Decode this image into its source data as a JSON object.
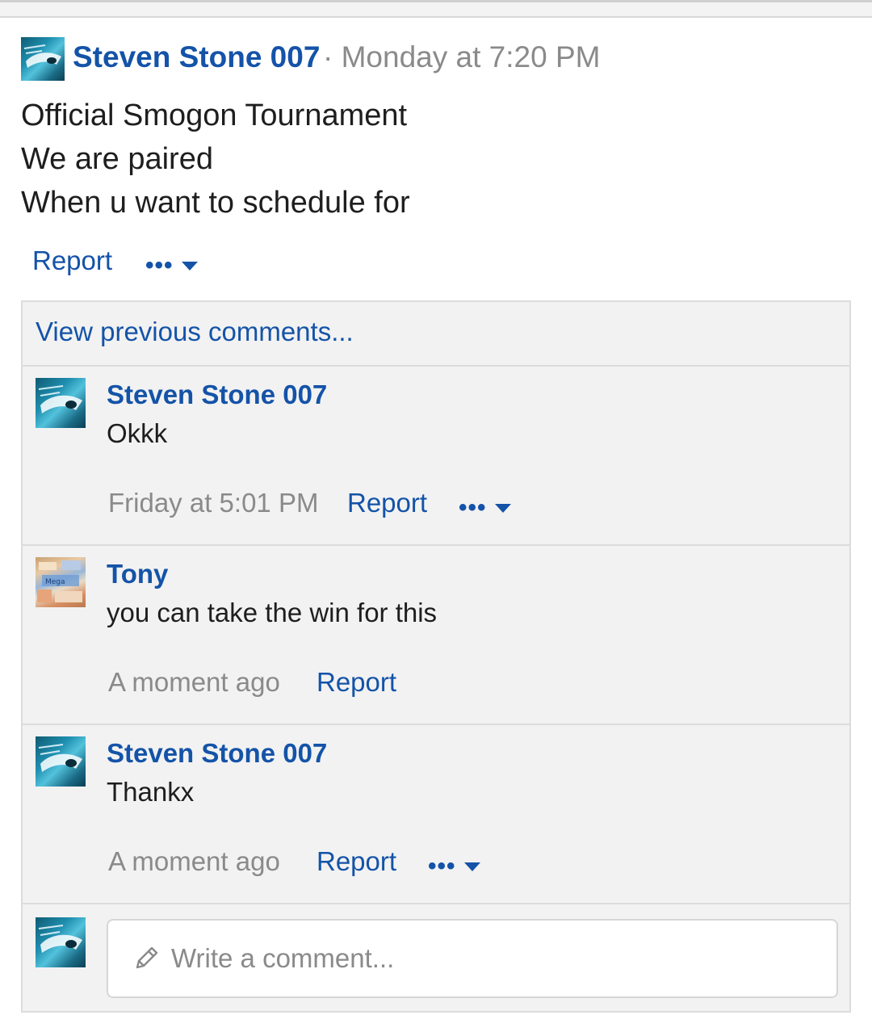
{
  "post": {
    "author": "Steven Stone 007",
    "timestamp": "· Monday at 7:20 PM",
    "lines": [
      "Official Smogon Tournament",
      "We are paired",
      "When u want to schedule for"
    ],
    "report_label": "Report",
    "more_label": "•••"
  },
  "comments_section": {
    "view_previous": "View previous comments...",
    "items": [
      {
        "author": "Steven Stone 007",
        "text": "Okkk",
        "time": "Friday at 5:01 PM",
        "report_label": "Report",
        "more_label": "•••"
      },
      {
        "author": "Tony",
        "text": "you can take the win for this",
        "time": "A moment ago",
        "report_label": "Report"
      },
      {
        "author": "Steven Stone 007",
        "text": "Thankx",
        "time": "A moment ago",
        "report_label": "Report",
        "more_label": "•••"
      }
    ],
    "composer": {
      "placeholder": "Write a comment..."
    }
  },
  "colors": {
    "link": "#1453a8",
    "muted": "#8a8a8a",
    "panel": "#f2f2f2"
  },
  "icons": [
    "user-avatar",
    "more-dots-icon",
    "caret-down-icon",
    "pencil-icon"
  ]
}
